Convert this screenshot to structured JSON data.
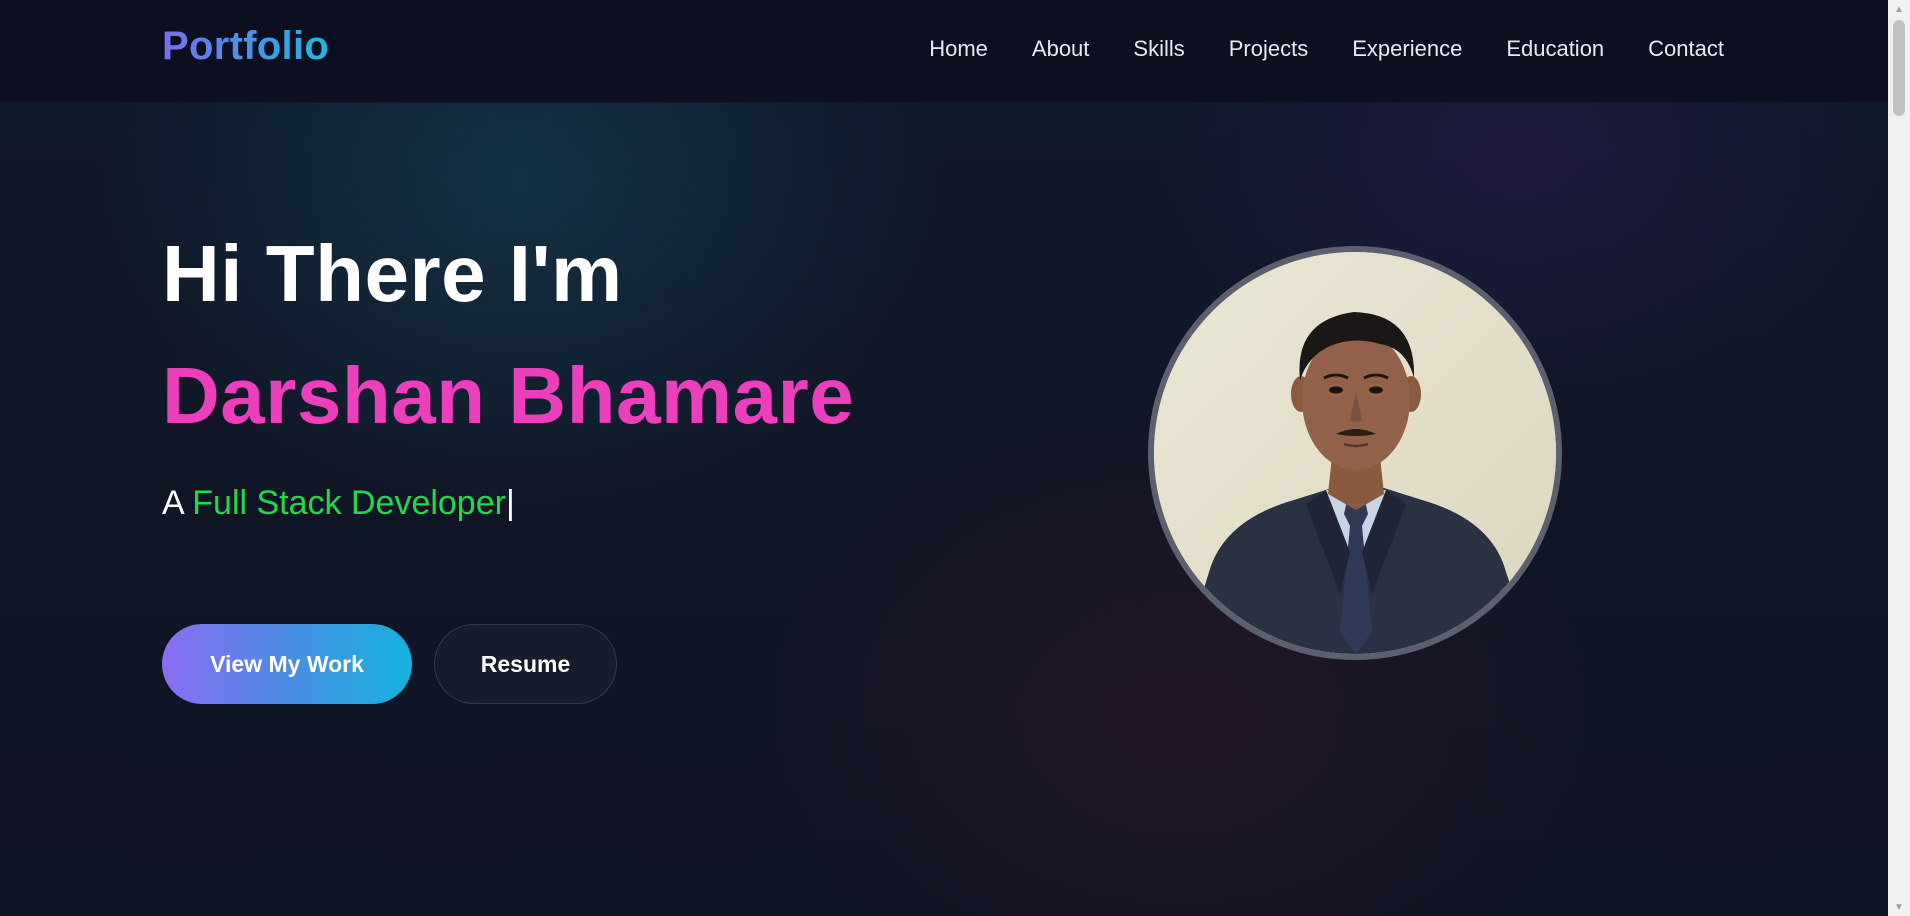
{
  "header": {
    "logo": "Portfolio",
    "nav": [
      "Home",
      "About",
      "Skills",
      "Projects",
      "Experience",
      "Education",
      "Contact"
    ]
  },
  "hero": {
    "greeting": "Hi There I'm",
    "name": "Darshan Bhamare",
    "tagline_prefix": "A",
    "tagline_role": "Full Stack Developer",
    "cursor": "|",
    "primary_button": "View My Work",
    "secondary_button": "Resume",
    "photo_icon": "profile-photo"
  },
  "colors": {
    "name": "#ec3fbd",
    "role": "#22d94a",
    "background": "#0e1220"
  }
}
